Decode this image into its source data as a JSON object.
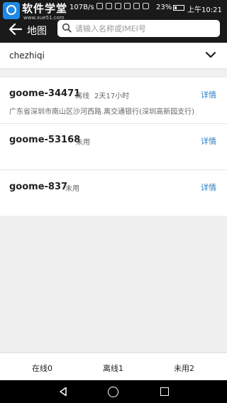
{
  "watermark": {
    "title": "软件学堂",
    "url": "www.xue51.com"
  },
  "statusbar": {
    "net_speed": "107B/s",
    "battery": "23%",
    "time": "上午10:21"
  },
  "appbar": {
    "back_label": "地图",
    "search_placeholder": "请输入名称或IMEI号"
  },
  "dropdown": {
    "value": "chezhiqi"
  },
  "devices": [
    {
      "name": "goome-34471",
      "status": "离线",
      "duration": "2天17小时",
      "detail": "详情",
      "address": "广东省深圳市南山区沙河西路.离交通银行(深圳高新园支行)"
    },
    {
      "name": "goome-53168",
      "status": "未用",
      "detail": "详情"
    },
    {
      "name": "goome-837",
      "status": "未用",
      "detail": "详情"
    }
  ],
  "tabs": [
    {
      "label": "在线0"
    },
    {
      "label": "离线1"
    },
    {
      "label": "未用2"
    }
  ]
}
